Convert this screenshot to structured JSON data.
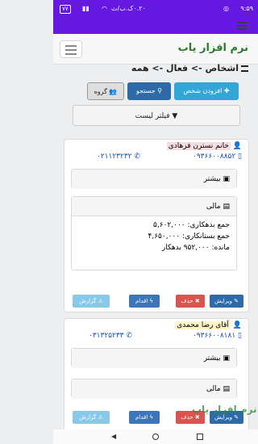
{
  "status": {
    "time": "۹:۵۹",
    "network": "۰.۲۰ک.ب/ث",
    "battery": "۷۷"
  },
  "app": {
    "brand": "نرم افزار یاب"
  },
  "breadcrumb": "اشخاص -> فعال -> همه",
  "toolbar": {
    "add_label": "افزودن شخص",
    "search_label": "جستجو",
    "group_label": "گروه"
  },
  "filter": {
    "label": "فیلتر لیست"
  },
  "persons": [
    {
      "name": "خانم نسترن فرهادی",
      "mobile": "۰۹۳۶۶۰۰۸۸۵۲",
      "phone": "۰۲۱۱۲۳۲۳۲",
      "more_label": "بیشتر",
      "finance_label": "مالی",
      "finance_lines": [
        "جمع بدهکاری: ۵,۶۰۲,۰۰۰",
        "جمع بستانکاری: ۴,۶۵۰,۰۰۰",
        "مانده: ۹۵۲,۰۰۰ بدهکار"
      ],
      "actions": {
        "edit": "ویرایش",
        "delete": "حذف",
        "act": "اقدام",
        "report": "گزارش"
      }
    },
    {
      "name": "آقای رضا محمدی",
      "mobile": "۰۹۳۶۶۰۰۸۱۸۱",
      "phone": "۰۳۱۳۲۵۲۳۳",
      "more_label": "بیشتر",
      "finance_label": "مالی",
      "actions": {
        "edit": "ویرایش",
        "delete": "حذف",
        "act": "اقدام",
        "report": "گزارش"
      }
    }
  ],
  "watermark": "نرم افزار یاب"
}
